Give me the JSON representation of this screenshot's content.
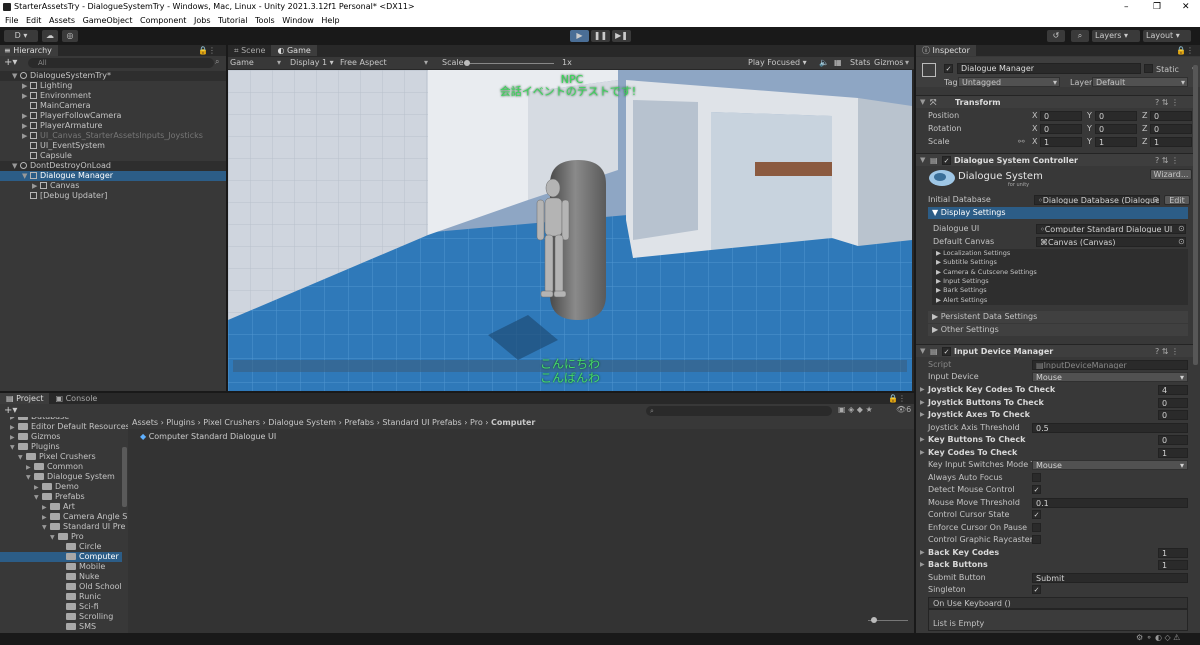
{
  "window": {
    "title": "StarterAssetsTry - DialogueSystemTry - Windows, Mac, Linux - Unity 2021.3.12f1 Personal* <DX11>",
    "controls": [
      "–",
      "❐",
      "✕"
    ]
  },
  "menu": [
    "File",
    "Edit",
    "Assets",
    "GameObject",
    "Component",
    "Jobs",
    "Tutorial",
    "Tools",
    "Window",
    "Help"
  ],
  "toolbar": {
    "account": "D ▾",
    "layers": "Layers",
    "layout": "Layout"
  },
  "hierarchy": {
    "tab": "Hierarchy",
    "search_placeholder": "All",
    "rows": [
      {
        "label": "DialogueSystemTry*",
        "depth": 0,
        "kind": "scene"
      },
      {
        "label": "Lighting",
        "depth": 1
      },
      {
        "label": "Environment",
        "depth": 1
      },
      {
        "label": "MainCamera",
        "depth": 1
      },
      {
        "label": "PlayerFollowCamera",
        "depth": 1
      },
      {
        "label": "PlayerArmature",
        "depth": 1
      },
      {
        "label": "UI_Canvas_StarterAssetsInputs_Joysticks",
        "depth": 1,
        "dim": true
      },
      {
        "label": "UI_EventSystem",
        "depth": 1
      },
      {
        "label": "Capsule",
        "depth": 1
      },
      {
        "label": "DontDestroyOnLoad",
        "depth": 0,
        "kind": "scene"
      },
      {
        "label": "Dialogue Manager",
        "depth": 1,
        "selected": true
      },
      {
        "label": "Canvas",
        "depth": 2
      },
      {
        "label": "[Debug Updater]",
        "depth": 1
      }
    ]
  },
  "scene_tabs": {
    "scene": "Scene",
    "game": "Game"
  },
  "game_toolbar": {
    "mode": "Game",
    "display": "Display 1",
    "aspect": "Free Aspect",
    "scale_label": "Scale",
    "scale_value": "1x",
    "play_focused": "Play Focused",
    "stats": "Stats",
    "gizmos": "Gizmos"
  },
  "game_text": {
    "npc_name": "NPC",
    "npc_line": "会話イベントのテストです!",
    "player_line1": "こんにちわ",
    "player_line2": "こんばんわ"
  },
  "project": {
    "tabs": [
      "Project",
      "Console"
    ],
    "breadcrumb": [
      "Assets",
      "Plugins",
      "Pixel Crushers",
      "Dialogue System",
      "Prefabs",
      "Standard UI Prefabs",
      "Pro",
      "Computer"
    ],
    "tree": [
      {
        "label": "Database",
        "depth": 1
      },
      {
        "label": "Editor Default Resources",
        "depth": 1
      },
      {
        "label": "Gizmos",
        "depth": 1
      },
      {
        "label": "Plugins",
        "depth": 1
      },
      {
        "label": "Pixel Crushers",
        "depth": 2
      },
      {
        "label": "Common",
        "depth": 3
      },
      {
        "label": "Dialogue System",
        "depth": 3
      },
      {
        "label": "Demo",
        "depth": 4
      },
      {
        "label": "Prefabs",
        "depth": 4
      },
      {
        "label": "Art",
        "depth": 5
      },
      {
        "label": "Camera Angle S",
        "depth": 5
      },
      {
        "label": "Standard UI Pre",
        "depth": 5
      },
      {
        "label": "Pro",
        "depth": 6
      },
      {
        "label": "Circle",
        "depth": 7
      },
      {
        "label": "Computer",
        "depth": 7,
        "selected": true
      },
      {
        "label": "Mobile",
        "depth": 7
      },
      {
        "label": "Nuke",
        "depth": 7
      },
      {
        "label": "Old School",
        "depth": 7
      },
      {
        "label": "Runic",
        "depth": 7
      },
      {
        "label": "Sci-fi",
        "depth": 7
      },
      {
        "label": "Scrolling",
        "depth": 7
      },
      {
        "label": "SMS",
        "depth": 7
      }
    ],
    "asset": "Computer Standard Dialogue UI",
    "hidden_count": "6"
  },
  "inspector": {
    "tab": "Inspector",
    "object_name": "Dialogue Manager",
    "static_label": "Static",
    "tag_label": "Tag",
    "tag": "Untagged",
    "layer_label": "Layer",
    "layer": "Default",
    "transform": {
      "title": "Transform",
      "rows": [
        {
          "label": "Position",
          "x": "0",
          "y": "0",
          "z": "0"
        },
        {
          "label": "Rotation",
          "x": "0",
          "y": "0",
          "z": "0"
        },
        {
          "label": "Scale",
          "x": "1",
          "y": "1",
          "z": "1"
        }
      ]
    },
    "dsc": {
      "title": "Dialogue System Controller",
      "logo": "Dialogue System",
      "logo_sub": "for unity",
      "wizard": "Wizard...",
      "initial_db_label": "Initial Database",
      "initial_db": "Dialogue Database (Dialogue Da",
      "edit": "Edit",
      "display_settings": "Display Settings",
      "dialogue_ui_label": "Dialogue UI",
      "dialogue_ui": "Computer Standard Dialogue UI",
      "default_canvas_label": "Default Canvas",
      "default_canvas": "Canvas (Canvas)",
      "sub_settings": [
        "Localization Settings",
        "Subtitle Settings",
        "Camera & Cutscene Settings",
        "Input Settings",
        "Bark Settings",
        "Alert Settings"
      ],
      "persistent": "Persistent Data Settings",
      "other": "Other Settings"
    },
    "idm": {
      "title": "Input Device Manager",
      "script_label": "Script",
      "script": "InputDeviceManager",
      "input_device_label": "Input Device",
      "input_device": "Mouse",
      "fields": [
        {
          "label": "Joystick Key Codes To Check",
          "value": "4",
          "bold": true
        },
        {
          "label": "Joystick Buttons To Check",
          "value": "0",
          "bold": true
        },
        {
          "label": "Joystick Axes To Check",
          "value": "0",
          "bold": true
        },
        {
          "label": "Joystick Axis Threshold",
          "value": "0.5"
        },
        {
          "label": "Key Buttons To Check",
          "value": "0",
          "bold": true
        },
        {
          "label": "Key Codes To Check",
          "value": "1",
          "bold": true
        },
        {
          "label": "Key Input Switches Mode To",
          "value": "Mouse",
          "dropdown": true
        },
        {
          "label": "Always Auto Focus",
          "check": false
        },
        {
          "label": "Detect Mouse Control",
          "check": true
        },
        {
          "label": "Mouse Move Threshold",
          "value": "0.1"
        },
        {
          "label": "Control Cursor State",
          "check": true
        },
        {
          "label": "Enforce Cursor On Pause",
          "check": false
        },
        {
          "label": "Control Graphic Raycasters",
          "check": false
        },
        {
          "label": "Back Key Codes",
          "value": "1",
          "bold": true
        },
        {
          "label": "Back Buttons",
          "value": "1",
          "bold": true
        },
        {
          "label": "Submit Button",
          "value": "Submit"
        },
        {
          "label": "Singleton",
          "check": true
        }
      ],
      "event_label": "On Use Keyboard ()",
      "list_empty": "List is Empty"
    }
  },
  "colors": {
    "accent_selection": "#2c5d87",
    "npc_text": "#3ad65a",
    "floor": "#2e78b8"
  }
}
